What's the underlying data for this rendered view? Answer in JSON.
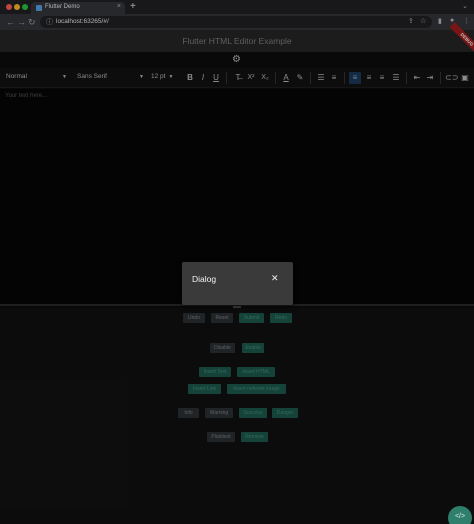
{
  "browser": {
    "tab_title": "Flutter Demo",
    "tab_close": "×",
    "new_tab": "+",
    "url": "localhost:63265/#/"
  },
  "app": {
    "title": "Flutter HTML Editor Example",
    "debug_banner": "DEBUG"
  },
  "editor_toolbar": {
    "paragraph_style": "Normal",
    "font_family": "Sans Serif",
    "font_size": "12 pt",
    "bold": "B",
    "italic": "I",
    "underline": "U",
    "clear_format": "T̶",
    "superscript": "X²",
    "subscript": "X₂"
  },
  "editor": {
    "placeholder": "Your text here..."
  },
  "buttons": {
    "undo": "Undo",
    "reset": "Reset",
    "submit": "Submit",
    "redo": "Redo",
    "disable": "Disable",
    "enable": "Enable",
    "insert_text": "Insert Text",
    "insert_html": "Insert HTML",
    "insert_link": "Insert Link",
    "insert_network_image": "Insert network image",
    "info": "Info",
    "warning": "Warning",
    "success": "Success",
    "danger": "Danger",
    "plaintext": "Plaintext",
    "remove": "Remove"
  },
  "dialog": {
    "title": "Dialog",
    "close": "✕"
  },
  "fab": {
    "label": "</>"
  },
  "colors": {
    "accent_teal": "#1e5a4c",
    "button_grey": "#2c3034",
    "dialog_bg": "#3a3a3a"
  }
}
